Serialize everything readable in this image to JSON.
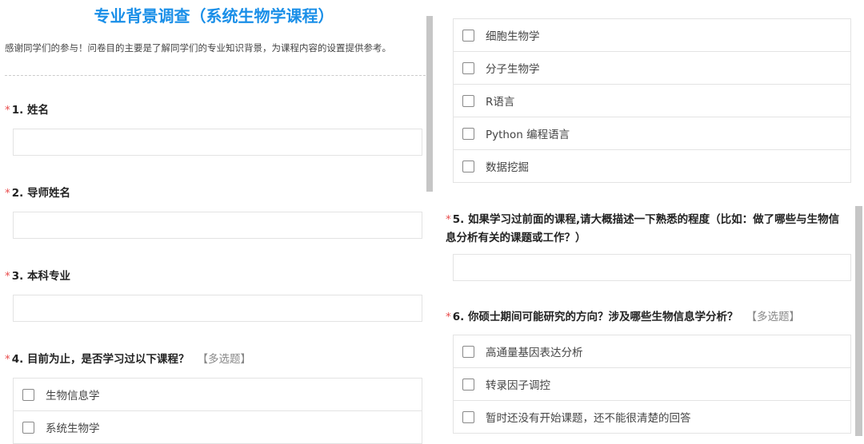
{
  "title": "专业背景调查（系统生物学课程）",
  "intro": "感谢同学们的参与！问卷目的主要是了解同学们的专业知识背景，为课程内容的设置提供参考。",
  "required_mark": "*",
  "questions": [
    {
      "label": "1. 姓名"
    },
    {
      "label": "2. 导师姓名"
    },
    {
      "label": "3. 本科专业"
    },
    {
      "label": "4. 目前为止，是否学习过以下课程？",
      "tag": "【多选题】",
      "options": [
        "生物信息学",
        "系统生物学",
        "细胞生物学",
        "分子生物学",
        "R语言",
        "Python 编程语言",
        "数据挖掘"
      ]
    },
    {
      "label": "5. 如果学习过前面的课程,请大概描述一下熟悉的程度（比如：做了哪些与生物信息分析有关的课题或工作？）"
    },
    {
      "label": "6. 你硕士期间可能研究的方向？涉及哪些生物信息学分析？",
      "tag": "【多选题】",
      "options": [
        "高通量基因表达分析",
        "转录因子调控",
        "暂时还没有开始课题，还不能很清楚的回答"
      ]
    }
  ]
}
